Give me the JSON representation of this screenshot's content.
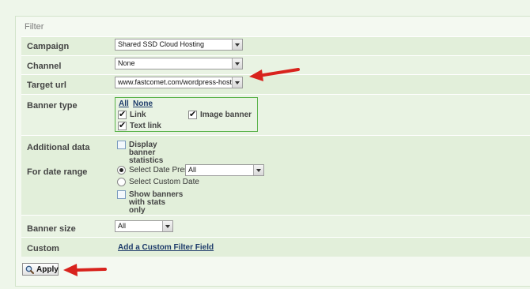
{
  "filter": {
    "legend": "Filter",
    "campaign": {
      "label": "Campaign",
      "value": "Shared SSD Cloud Hosting"
    },
    "channel": {
      "label": "Channel",
      "value": "None"
    },
    "target_url": {
      "label": "Target url",
      "value": "www.fastcomet.com/wordpress-hosting"
    },
    "banner_type": {
      "label": "Banner type",
      "all_link": "All",
      "none_link": "None",
      "options": [
        {
          "label": "Link",
          "checked": true
        },
        {
          "label": "Text link",
          "checked": true
        },
        {
          "label": "Image banner",
          "checked": true
        }
      ]
    },
    "additional_data": {
      "label": "Additional data",
      "display_stats_line1": "Display",
      "display_stats_line2": "banner",
      "display_stats_line3": "statistics",
      "display_stats_checked": false
    },
    "date_range": {
      "label": "For date range",
      "preset_label": "Select Date Preset",
      "preset_selected": true,
      "preset_value": "All",
      "custom_label": "Select Custom Date",
      "custom_selected": false,
      "show_banners_line1": "Show banners",
      "show_banners_line2": "with stats",
      "show_banners_line3": "only",
      "show_banners_checked": false
    },
    "banner_size": {
      "label": "Banner size",
      "value": "All"
    },
    "custom": {
      "label": "Custom",
      "link": "Add a Custom Filter Field"
    }
  },
  "actions": {
    "apply_label": "Apply"
  },
  "colors": {
    "annotation_arrow": "#d8231d",
    "box_border": "#5ab34a",
    "link": "#1d3b6a"
  }
}
